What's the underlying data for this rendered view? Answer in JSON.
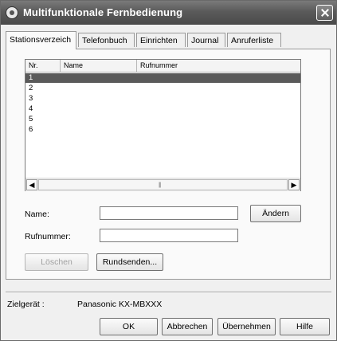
{
  "window": {
    "title": "Multifunktionale Fernbedienung"
  },
  "tabs": [
    {
      "label": "Stationsverzeich"
    },
    {
      "label": "Telefonbuch"
    },
    {
      "label": "Einrichten"
    },
    {
      "label": "Journal"
    },
    {
      "label": "Anruferliste"
    }
  ],
  "list": {
    "columns": [
      "Nr.",
      "Name",
      "Rufnummer"
    ],
    "rows": [
      "1",
      "2",
      "3",
      "4",
      "5",
      "6"
    ],
    "selected_index": 0
  },
  "form": {
    "name_label": "Name:",
    "name_value": "",
    "number_label": "Rufnummer:",
    "number_value": "",
    "change_button": "Ändern",
    "delete_button": "Löschen",
    "broadcast_button": "Rundsenden..."
  },
  "target": {
    "label": "Zielgerät :",
    "device": "Panasonic KX-MBXXX"
  },
  "footer": {
    "ok": "OK",
    "cancel": "Abbrechen",
    "apply": "Übernehmen",
    "help": "Hilfe"
  },
  "colors": {
    "titlebar": "#5a5a5a",
    "selection": "#5a5a5a"
  }
}
